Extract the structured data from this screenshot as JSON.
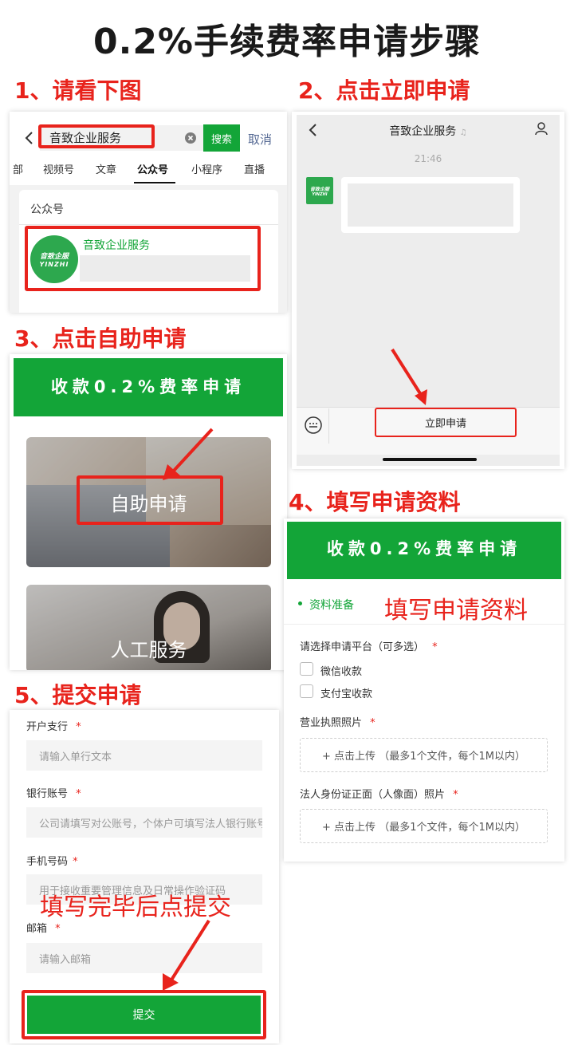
{
  "title": "0.2%手续费率申请步骤",
  "steps": {
    "s1": "1、请看下图",
    "s2": "2、点击立即申请",
    "s3": "3、点击自助申请",
    "s4": "4、填写申请资料",
    "s5": "5、提交申请"
  },
  "search": {
    "query": "音致企业服务",
    "search_btn": "搜索",
    "cancel": "取消",
    "tabs": [
      "部",
      "视频号",
      "文章",
      "公众号",
      "小程序",
      "直播"
    ],
    "section_label": "公众号",
    "result_name": "音致企业服务",
    "logo_top": "音致企服",
    "logo_bottom": "YINZHI"
  },
  "chat": {
    "title": "音致企业服务",
    "time": "21:46",
    "logo_top": "音致企服",
    "logo_bottom": "YINZHI",
    "apply_button": "立即申请"
  },
  "self_service": {
    "banner": "收款0.2%费率申请",
    "self_label": "自助申请",
    "manual_label": "人工服务"
  },
  "form4": {
    "banner": "收款0.2%费率申请",
    "section": "资料准备",
    "annotation": "填写申请资料",
    "platform_label": "请选择申请平台（可多选）",
    "options": [
      "微信收款",
      "支付宝收款"
    ],
    "license_label": "营业执照照片",
    "upload_text": "+ 点击上传 （最多1个文件，每个1M以内）",
    "id_label": "法人身份证正面（人像面）照片",
    "upload_text2": "+ 点击上传 （最多1个文件，每个1M以内）",
    "star": "*"
  },
  "form5": {
    "bank_branch_label": "开户支行",
    "bank_branch_placeholder": "请输入单行文本",
    "account_label": "银行账号",
    "account_placeholder": "公司请填写对公账号，个体户可填写法人银行账号",
    "phone_label": "手机号码",
    "phone_placeholder": "用于接收重要管理信息及日常操作验证码",
    "email_label": "邮箱",
    "email_placeholder": "请输入邮箱",
    "submit": "提交",
    "annotation": "填写完毕后点提交",
    "star": "*"
  }
}
